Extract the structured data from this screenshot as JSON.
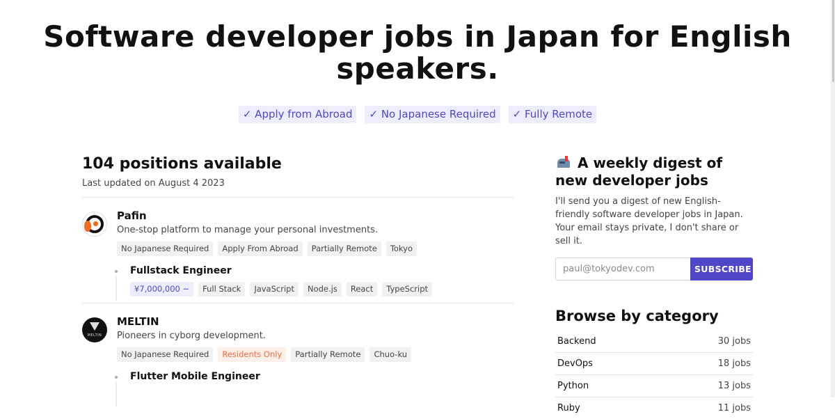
{
  "hero": {
    "title": "Software developer jobs in Japan for English speakers.",
    "pills": [
      "✓ Apply from Abroad",
      "✓ No Japanese Required",
      "✓ Fully Remote"
    ]
  },
  "listing": {
    "positions_count": "104 positions available",
    "last_updated": "Last updated on August 4 2023",
    "companies": [
      {
        "name": "Pafin",
        "logo_icon": "pafin-logo",
        "description": "One-stop platform to manage your personal investments.",
        "tags": [
          "No Japanese Required",
          "Apply From Abroad",
          "Partially Remote",
          "Tokyo"
        ],
        "job": {
          "title": "Fullstack Engineer",
          "salary": "¥7,000,000 ~",
          "tags": [
            "Full Stack",
            "JavaScript",
            "Node.js",
            "React",
            "TypeScript"
          ]
        }
      },
      {
        "name": "MELTIN",
        "logo_icon": "meltin-logo",
        "logo_text": "MELTIN",
        "description": "Pioneers in cyborg development.",
        "tags": [
          "No Japanese Required",
          "Residents Only",
          "Partially Remote",
          "Chuo-ku"
        ],
        "warning_tag": "Residents Only",
        "job": {
          "title": "Flutter Mobile Engineer"
        }
      }
    ]
  },
  "sidebar": {
    "digest_icon": "mailbox-icon",
    "digest_title": "A weekly digest of new developer jobs",
    "digest_text": "I'll send you a digest of new English-friendly software developer jobs in Japan. Your email stays private, I don't share or sell it.",
    "email_placeholder": "paul@tokyodev.com",
    "subscribe_label": "SUBSCRIBE",
    "browse_title": "Browse by category",
    "categories": [
      {
        "name": "Backend",
        "count": "30 jobs"
      },
      {
        "name": "DevOps",
        "count": "18 jobs"
      },
      {
        "name": "Python",
        "count": "13 jobs"
      },
      {
        "name": "Ruby",
        "count": "11 jobs"
      }
    ]
  },
  "colors": {
    "accent": "#4f46c8",
    "accent_bg": "#eeedfb",
    "tag_bg": "#f1f1f4",
    "warning": "#ee6b3b",
    "warning_bg": "#fdf0ea"
  }
}
